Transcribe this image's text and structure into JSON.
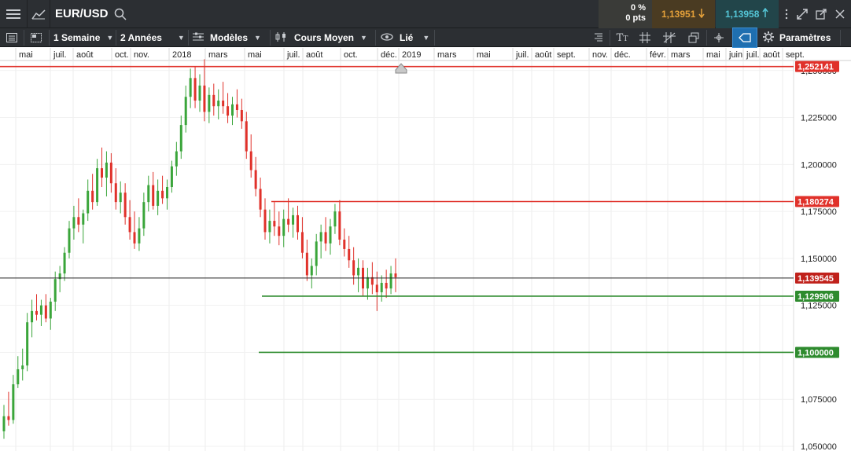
{
  "header": {
    "symbol": "EUR/USD",
    "change_pct": "0 %",
    "change_pts": "0 pts",
    "bid": "1,13951",
    "ask": "1,13958"
  },
  "toolbar": {
    "interval": "1 Semaine",
    "range": "2 Années",
    "templates": "Modèles",
    "price_type": "Cours Moyen",
    "linked": "Lié",
    "settings": "Paramètres"
  },
  "colors": {
    "up": "#3aa53a",
    "down": "#e0312a",
    "resistance": "#e0312a",
    "support": "#2e8b2e",
    "current": "#c0211b"
  },
  "chart_data": {
    "type": "candlestick",
    "title": "",
    "x_tick_labels": [
      "mai",
      "juil.",
      "août",
      "oct.",
      "nov.",
      "2018",
      "mars",
      "mai",
      "juil.",
      "août",
      "oct.",
      "déc.",
      "2019",
      "mars",
      "mai",
      "juil.",
      "août",
      "sept.",
      "nov.",
      "déc.",
      "févr.",
      "mars",
      "mai",
      "juin",
      "juil.",
      "août",
      "sept."
    ],
    "y_ticks": [
      "1,250000",
      "1,225000",
      "1,200000",
      "1,175000",
      "1,150000",
      "1,125000",
      "1,100000",
      "1,075000",
      "1,050000"
    ],
    "ylim": [
      1.0475,
      1.2545
    ],
    "horizontal_lines": [
      {
        "label": "1,252141",
        "value": 1.252141,
        "color": "red",
        "start": "start"
      },
      {
        "label": "1,180274",
        "value": 1.180274,
        "color": "red",
        "start": "2018-06"
      },
      {
        "label": "1,139545",
        "value": 1.139545,
        "color": "black",
        "start": "start"
      },
      {
        "label": "1,129906",
        "value": 1.129906,
        "color": "green",
        "start": "2018-05"
      },
      {
        "label": "1,100000",
        "value": 1.1,
        "color": "green",
        "start": "2018-05"
      }
    ],
    "candles": [
      [
        1.058,
        1.072,
        1.054,
        1.066
      ],
      [
        1.066,
        1.079,
        1.061,
        1.064
      ],
      [
        1.064,
        1.088,
        1.062,
        1.083
      ],
      [
        1.083,
        1.098,
        1.081,
        1.091
      ],
      [
        1.091,
        1.102,
        1.085,
        1.093
      ],
      [
        1.093,
        1.121,
        1.09,
        1.116
      ],
      [
        1.116,
        1.128,
        1.108,
        1.122
      ],
      [
        1.122,
        1.131,
        1.117,
        1.12
      ],
      [
        1.12,
        1.128,
        1.114,
        1.125
      ],
      [
        1.125,
        1.131,
        1.116,
        1.118
      ],
      [
        1.118,
        1.129,
        1.112,
        1.127
      ],
      [
        1.127,
        1.143,
        1.122,
        1.139
      ],
      [
        1.139,
        1.146,
        1.132,
        1.142
      ],
      [
        1.142,
        1.156,
        1.138,
        1.153
      ],
      [
        1.153,
        1.17,
        1.15,
        1.166
      ],
      [
        1.166,
        1.178,
        1.16,
        1.172
      ],
      [
        1.172,
        1.182,
        1.164,
        1.168
      ],
      [
        1.168,
        1.176,
        1.158,
        1.174
      ],
      [
        1.174,
        1.192,
        1.17,
        1.186
      ],
      [
        1.186,
        1.195,
        1.176,
        1.18
      ],
      [
        1.18,
        1.203,
        1.178,
        1.198
      ],
      [
        1.198,
        1.209,
        1.188,
        1.193
      ],
      [
        1.193,
        1.207,
        1.183,
        1.201
      ],
      [
        1.201,
        1.206,
        1.185,
        1.19
      ],
      [
        1.19,
        1.198,
        1.176,
        1.18
      ],
      [
        1.18,
        1.191,
        1.174,
        1.185
      ],
      [
        1.185,
        1.19,
        1.168,
        1.172
      ],
      [
        1.172,
        1.181,
        1.16,
        1.164
      ],
      [
        1.164,
        1.175,
        1.155,
        1.158
      ],
      [
        1.158,
        1.172,
        1.154,
        1.166
      ],
      [
        1.166,
        1.185,
        1.162,
        1.18
      ],
      [
        1.18,
        1.194,
        1.175,
        1.189
      ],
      [
        1.189,
        1.196,
        1.176,
        1.178
      ],
      [
        1.178,
        1.192,
        1.173,
        1.186
      ],
      [
        1.186,
        1.194,
        1.179,
        1.182
      ],
      [
        1.182,
        1.192,
        1.176,
        1.188
      ],
      [
        1.188,
        1.202,
        1.185,
        1.199
      ],
      [
        1.199,
        1.212,
        1.194,
        1.207
      ],
      [
        1.207,
        1.226,
        1.203,
        1.221
      ],
      [
        1.221,
        1.242,
        1.217,
        1.236
      ],
      [
        1.236,
        1.251,
        1.23,
        1.246
      ],
      [
        1.246,
        1.252,
        1.23,
        1.234
      ],
      [
        1.234,
        1.248,
        1.228,
        1.242
      ],
      [
        1.242,
        1.256,
        1.223,
        1.228
      ],
      [
        1.228,
        1.241,
        1.222,
        1.237
      ],
      [
        1.237,
        1.243,
        1.226,
        1.231
      ],
      [
        1.231,
        1.24,
        1.224,
        1.234
      ],
      [
        1.234,
        1.244,
        1.227,
        1.231
      ],
      [
        1.231,
        1.238,
        1.222,
        1.226
      ],
      [
        1.226,
        1.236,
        1.221,
        1.232
      ],
      [
        1.232,
        1.24,
        1.225,
        1.229
      ],
      [
        1.229,
        1.235,
        1.219,
        1.223
      ],
      [
        1.223,
        1.228,
        1.203,
        1.207
      ],
      [
        1.207,
        1.216,
        1.193,
        1.197
      ],
      [
        1.197,
        1.204,
        1.183,
        1.187
      ],
      [
        1.187,
        1.193,
        1.172,
        1.176
      ],
      [
        1.176,
        1.182,
        1.16,
        1.164
      ],
      [
        1.164,
        1.176,
        1.158,
        1.17
      ],
      [
        1.17,
        1.18,
        1.162,
        1.167
      ],
      [
        1.167,
        1.175,
        1.157,
        1.162
      ],
      [
        1.162,
        1.176,
        1.156,
        1.171
      ],
      [
        1.171,
        1.182,
        1.164,
        1.168
      ],
      [
        1.168,
        1.177,
        1.161,
        1.173
      ],
      [
        1.173,
        1.178,
        1.16,
        1.164
      ],
      [
        1.164,
        1.172,
        1.15,
        1.153
      ],
      [
        1.153,
        1.16,
        1.138,
        1.141
      ],
      [
        1.141,
        1.15,
        1.134,
        1.146
      ],
      [
        1.146,
        1.163,
        1.141,
        1.159
      ],
      [
        1.159,
        1.168,
        1.15,
        1.164
      ],
      [
        1.164,
        1.172,
        1.154,
        1.158
      ],
      [
        1.158,
        1.171,
        1.152,
        1.167
      ],
      [
        1.167,
        1.179,
        1.163,
        1.175
      ],
      [
        1.175,
        1.181,
        1.157,
        1.16
      ],
      [
        1.16,
        1.166,
        1.151,
        1.155
      ],
      [
        1.155,
        1.162,
        1.145,
        1.149
      ],
      [
        1.149,
        1.156,
        1.136,
        1.141
      ],
      [
        1.141,
        1.15,
        1.132,
        1.145
      ],
      [
        1.145,
        1.149,
        1.13,
        1.134
      ],
      [
        1.134,
        1.145,
        1.128,
        1.14
      ],
      [
        1.14,
        1.148,
        1.131,
        1.136
      ],
      [
        1.136,
        1.143,
        1.122,
        1.132
      ],
      [
        1.132,
        1.141,
        1.127,
        1.137
      ],
      [
        1.137,
        1.144,
        1.129,
        1.134
      ],
      [
        1.134,
        1.146,
        1.131,
        1.142
      ],
      [
        1.142,
        1.15,
        1.132,
        1.14
      ]
    ]
  }
}
